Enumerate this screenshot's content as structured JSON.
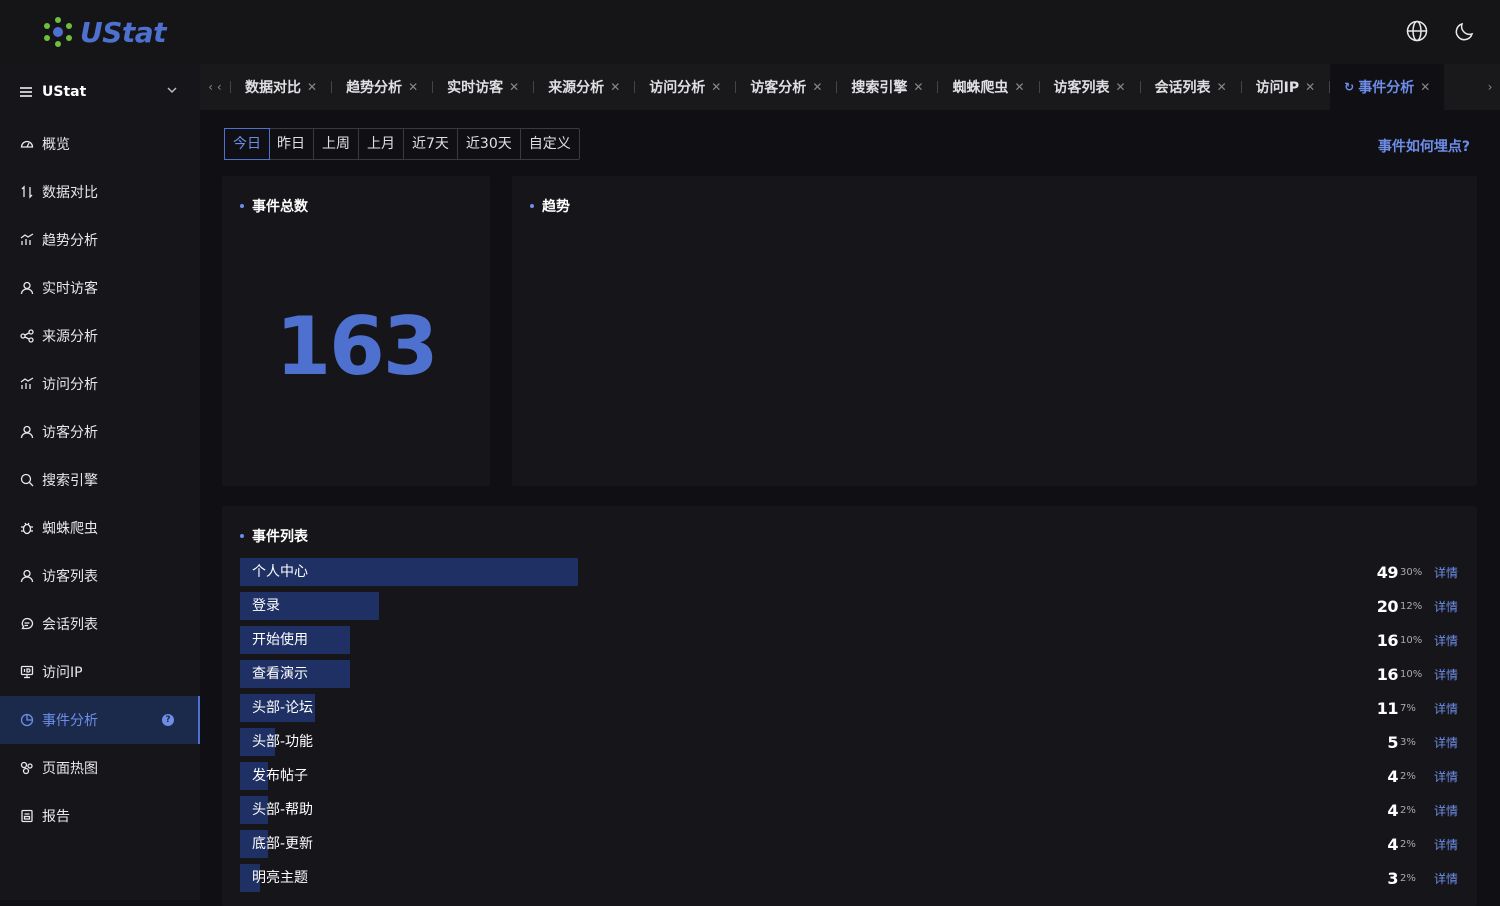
{
  "app": {
    "brand": "UStat"
  },
  "sidebar": {
    "site": "UStat",
    "items": [
      {
        "label": "概览",
        "icon": "dashboard-icon"
      },
      {
        "label": "数据对比",
        "icon": "compare-icon"
      },
      {
        "label": "趋势分析",
        "icon": "trend-icon"
      },
      {
        "label": "实时访客",
        "icon": "user-icon"
      },
      {
        "label": "来源分析",
        "icon": "share-icon"
      },
      {
        "label": "访问分析",
        "icon": "trend-icon"
      },
      {
        "label": "访客分析",
        "icon": "user-icon"
      },
      {
        "label": "搜索引擎",
        "icon": "search-icon"
      },
      {
        "label": "蜘蛛爬虫",
        "icon": "bug-icon"
      },
      {
        "label": "访客列表",
        "icon": "user-icon"
      },
      {
        "label": "会话列表",
        "icon": "chat-icon"
      },
      {
        "label": "访问IP",
        "icon": "ip-icon"
      },
      {
        "label": "事件分析",
        "icon": "pie-icon",
        "active": true
      },
      {
        "label": "页面热图",
        "icon": "heatmap-icon"
      },
      {
        "label": "报告",
        "icon": "report-icon"
      }
    ]
  },
  "tabs": [
    {
      "label": "数据对比"
    },
    {
      "label": "趋势分析"
    },
    {
      "label": "实时访客"
    },
    {
      "label": "来源分析"
    },
    {
      "label": "访问分析"
    },
    {
      "label": "访客分析"
    },
    {
      "label": "搜索引擎"
    },
    {
      "label": "蜘蛛爬虫"
    },
    {
      "label": "访客列表"
    },
    {
      "label": "会话列表"
    },
    {
      "label": "访问IP"
    },
    {
      "label": "事件分析",
      "active": true
    }
  ],
  "range": {
    "options": [
      "今日",
      "昨日",
      "上周",
      "上月",
      "近7天",
      "近30天",
      "自定义"
    ],
    "selected": "今日"
  },
  "howto_link": "事件如何埋点?",
  "total_card": {
    "title": "事件总数",
    "value": "163"
  },
  "trend_card": {
    "title": "趋势"
  },
  "events": {
    "title": "事件列表",
    "detail_label": "详情",
    "rows": [
      {
        "name": "个人中心",
        "count": 49,
        "pct": "30%",
        "share": 0.3
      },
      {
        "name": "登录",
        "count": 20,
        "pct": "12%",
        "share": 0.123
      },
      {
        "name": "开始使用",
        "count": 16,
        "pct": "10%",
        "share": 0.098
      },
      {
        "name": "查看演示",
        "count": 16,
        "pct": "10%",
        "share": 0.098
      },
      {
        "name": "头部-论坛",
        "count": 11,
        "pct": "7%",
        "share": 0.067
      },
      {
        "name": "头部-功能",
        "count": 5,
        "pct": "3%",
        "share": 0.031
      },
      {
        "name": "发布帖子",
        "count": 4,
        "pct": "2%",
        "share": 0.025
      },
      {
        "name": "头部-帮助",
        "count": 4,
        "pct": "2%",
        "share": 0.025
      },
      {
        "name": "底部-更新",
        "count": 4,
        "pct": "2%",
        "share": 0.025
      },
      {
        "name": "明亮主题",
        "count": 3,
        "pct": "2%",
        "share": 0.018
      }
    ]
  },
  "colors": {
    "accent": "#4e70cf",
    "bar": "#1f3064",
    "link": "#6d8de8"
  }
}
